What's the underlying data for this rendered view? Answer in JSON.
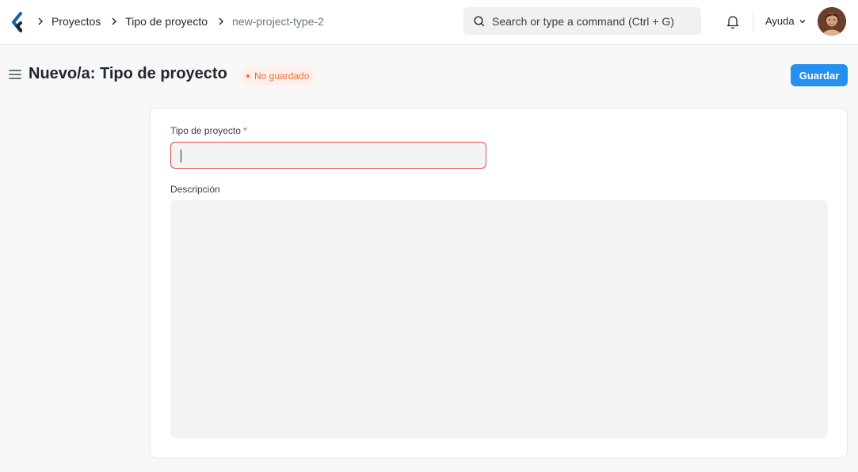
{
  "breadcrumbs": [
    {
      "label": "Proyectos"
    },
    {
      "label": "Tipo de proyecto"
    },
    {
      "label": "new-project-type-2"
    }
  ],
  "search": {
    "placeholder": "Search or type a command (Ctrl + G)"
  },
  "help": {
    "label": "Ayuda"
  },
  "page": {
    "title": "Nuevo/a: Tipo de proyecto",
    "status": "No guardado",
    "save_label": "Guardar"
  },
  "form": {
    "project_type": {
      "label": "Tipo de proyecto",
      "required_mark": "*",
      "value": ""
    },
    "description": {
      "label": "Descripción",
      "value": ""
    }
  },
  "colors": {
    "primary": "#2490ef",
    "status": "#e8703a",
    "error": "#e24c4c"
  },
  "icons": [
    "logo-icon",
    "chevron-right-icon",
    "search-icon",
    "bell-icon",
    "chevron-down-icon",
    "hamburger-icon"
  ]
}
